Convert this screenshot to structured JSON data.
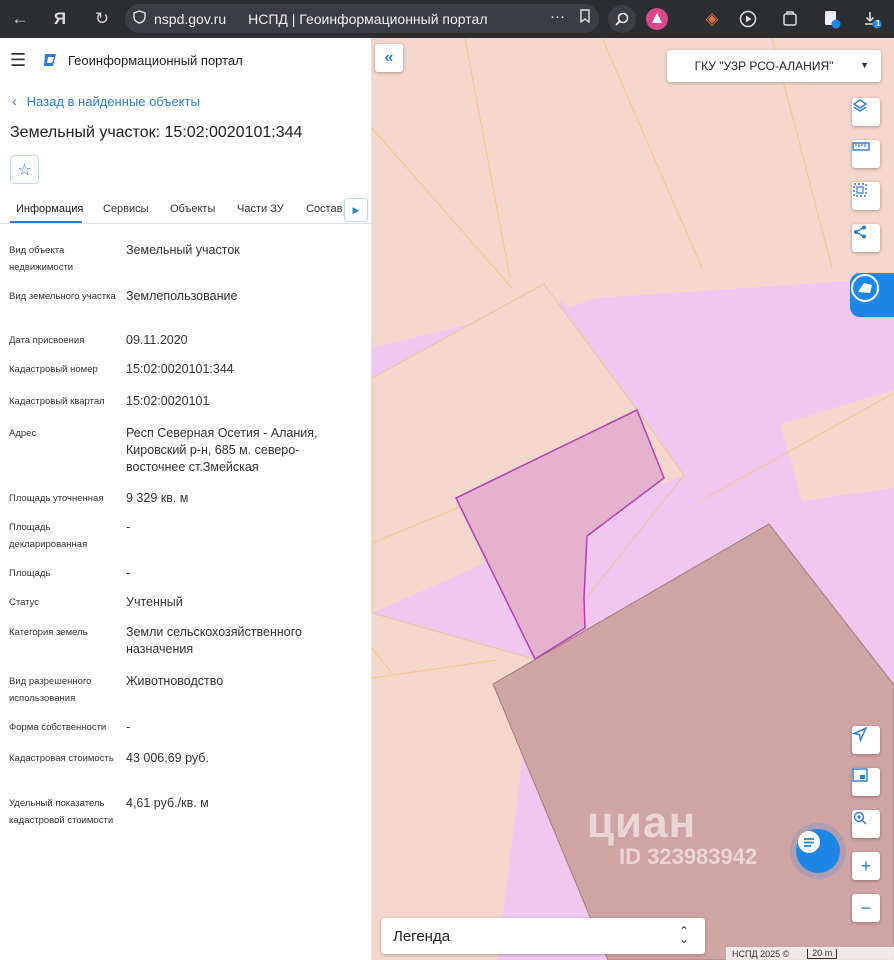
{
  "browser": {
    "domain": "nspd.gov.ru",
    "page_title": "НСПД | Геоинформационный портал",
    "notification_count": "1"
  },
  "sidebar": {
    "portal_name": "Геоинформационный портал",
    "back_link": "Назад в найденные объекты",
    "title": "Земельный участок: 15:02:0020101:344",
    "tabs": [
      "Информация",
      "Сервисы",
      "Объекты",
      "Части ЗУ",
      "Состав"
    ],
    "properties": [
      {
        "label": "Вид объекта недвижимости",
        "value": "Земельный участок"
      },
      {
        "label": "Вид земельного участка",
        "value": "Землепользование"
      },
      {
        "label": "Дата присвоения",
        "value": "09.11.2020"
      },
      {
        "label": "Кадастровый номер",
        "value": "15:02:0020101:344"
      },
      {
        "label": "Кадастровый квартал",
        "value": "15:02:0020101"
      },
      {
        "label": "Адрес",
        "value": "Респ Северная Осетия - Алания, Кировский р-н, 685 м. северо-восточнее ст.Змейская"
      },
      {
        "label": "Площадь уточненная",
        "value": "9 329 кв. м"
      },
      {
        "label": "Площадь декларированная",
        "value": "-"
      },
      {
        "label": "Площадь",
        "value": "-"
      },
      {
        "label": "Статус",
        "value": "Учтенный"
      },
      {
        "label": "Категория земель",
        "value": "Земли сельскохозяйственного назначения"
      },
      {
        "label": "Вид разрешенного использования",
        "value": "Животноводство"
      },
      {
        "label": "Форма собственности",
        "value": "-"
      },
      {
        "label": "Кадастровая стоимость",
        "value": "43 006,69 руб."
      },
      {
        "label": "Удельный показатель кадастровой стоимости",
        "value": "4,61 руб./кв. м"
      }
    ]
  },
  "map": {
    "org_select": "ГКУ \"УЗР РСО-АЛАНИЯ\"",
    "legend_label": "Легенда",
    "copyright": "НСПД 2025 ©",
    "scale_label": "20 m",
    "watermark_brand": "циан",
    "watermark_id": "ID 323983942",
    "colors": {
      "background": "#f3d6cc",
      "pink_zone": "#efc8ef",
      "selected_parcel": "#e3b1cb",
      "selected_border": "#b93fb6",
      "large_parcel": "#cfa4a4",
      "accent": "#2f7bd1"
    }
  }
}
